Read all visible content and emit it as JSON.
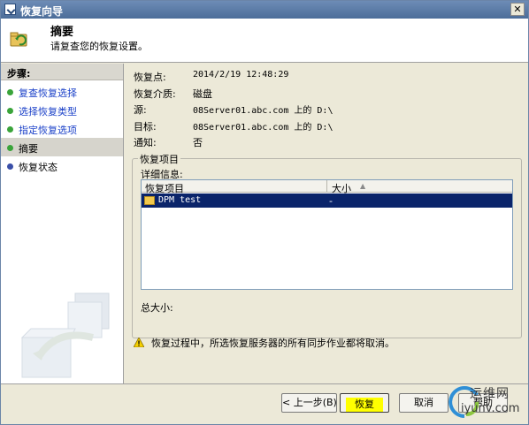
{
  "window": {
    "title": "恢复向导",
    "close_glyph": "✕"
  },
  "header": {
    "title": "摘要",
    "subtitle": "请复查您的恢复设置。",
    "icon": "restore-wizard-icon"
  },
  "nav": {
    "heading": "步骤:",
    "items": [
      {
        "label": "复查恢复选择",
        "link": true,
        "dot_color": "#3aa43a"
      },
      {
        "label": "选择恢复类型",
        "link": true,
        "dot_color": "#3aa43a"
      },
      {
        "label": "指定恢复选项",
        "link": true,
        "dot_color": "#3aa43a"
      },
      {
        "label": "摘要",
        "link": false,
        "active": true,
        "dot_color": "#3aa43a"
      },
      {
        "label": "恢复状态",
        "link": false,
        "dot_color": "#3a4fa8"
      }
    ]
  },
  "summary": {
    "fields": [
      {
        "key": "恢复点:",
        "value": "2014/2/19 12:48:29"
      },
      {
        "key": "恢复介质:",
        "value": "磁盘"
      },
      {
        "key": "源:",
        "value": "08Server01.abc.com 上的 D:\\"
      },
      {
        "key": "目标:",
        "value": "08Server01.abc.com 上的 D:\\"
      },
      {
        "key": "通知:",
        "value": "否"
      }
    ]
  },
  "recovery_items": {
    "group_label": "恢复项目",
    "detail_label": "详细信息:",
    "columns": [
      "恢复项目",
      "大小"
    ],
    "sort_glyph": "▲",
    "rows": [
      {
        "name": "DPM test",
        "size": "-"
      }
    ],
    "total_label": "总大小:"
  },
  "warning": {
    "text": "恢复过程中，所选恢复服务器的所有同步作业都将取消。",
    "icon": "warning-icon"
  },
  "buttons": {
    "back": "< 上一步(B)",
    "recover": "恢复",
    "cancel": "取消",
    "help": "帮助"
  },
  "watermark": {
    "cn": "运维网",
    "en": "iyunv.com"
  },
  "colors": {
    "titlebar": "#5c7ba6",
    "selection": "#0a246a",
    "link": "#1a40c8",
    "highlight": "#ffff00"
  }
}
